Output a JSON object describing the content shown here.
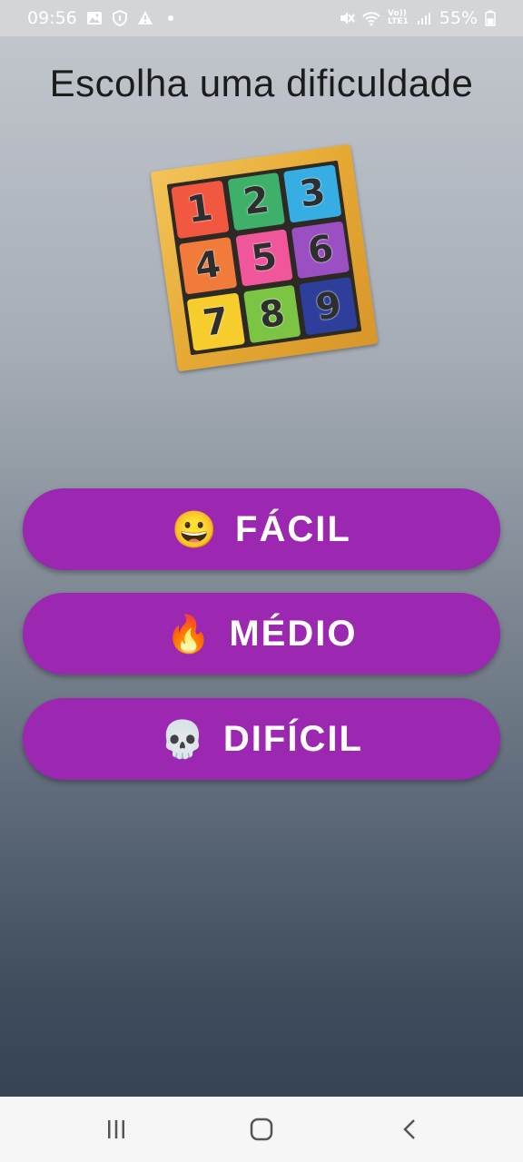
{
  "status_bar": {
    "time": "09:56",
    "left_icons": [
      "image-icon",
      "shield-icon",
      "warning-icon",
      "dot-icon"
    ],
    "right_icons": [
      "mute-icon",
      "wifi-icon",
      "lte-icon",
      "signal-icon"
    ],
    "lte_top": "Vo))",
    "lte_bottom": "LTE1",
    "battery_percent": "55%",
    "battery_level": 0.55
  },
  "screen": {
    "title": "Escolha uma dificuldade"
  },
  "puzzle_image": {
    "tiles": [
      {
        "label": "1",
        "color": "#f2573f"
      },
      {
        "label": "2",
        "color": "#3fb06a"
      },
      {
        "label": "3",
        "color": "#37aee3"
      },
      {
        "label": "4",
        "color": "#f07b3a"
      },
      {
        "label": "5",
        "color": "#f0569a"
      },
      {
        "label": "6",
        "color": "#9a4fc2"
      },
      {
        "label": "7",
        "color": "#f6cd2c"
      },
      {
        "label": "8",
        "color": "#7cc544"
      },
      {
        "label": "9",
        "color": "#2d3f9b"
      }
    ]
  },
  "difficulty_buttons": [
    {
      "emoji": "😀",
      "icon": "grinning-face-icon",
      "label": "FÁCIL"
    },
    {
      "emoji": "🔥",
      "icon": "fire-icon",
      "label": "MÉDIO"
    },
    {
      "emoji": "💀",
      "icon": "skull-icon",
      "label": "DIFÍCIL"
    }
  ],
  "colors": {
    "button": "#9c27b0",
    "button_text": "#ffffff",
    "title_text": "#1c1c1c"
  },
  "nav_bar": {
    "buttons": [
      "recent-apps-icon",
      "home-icon",
      "back-icon"
    ]
  }
}
